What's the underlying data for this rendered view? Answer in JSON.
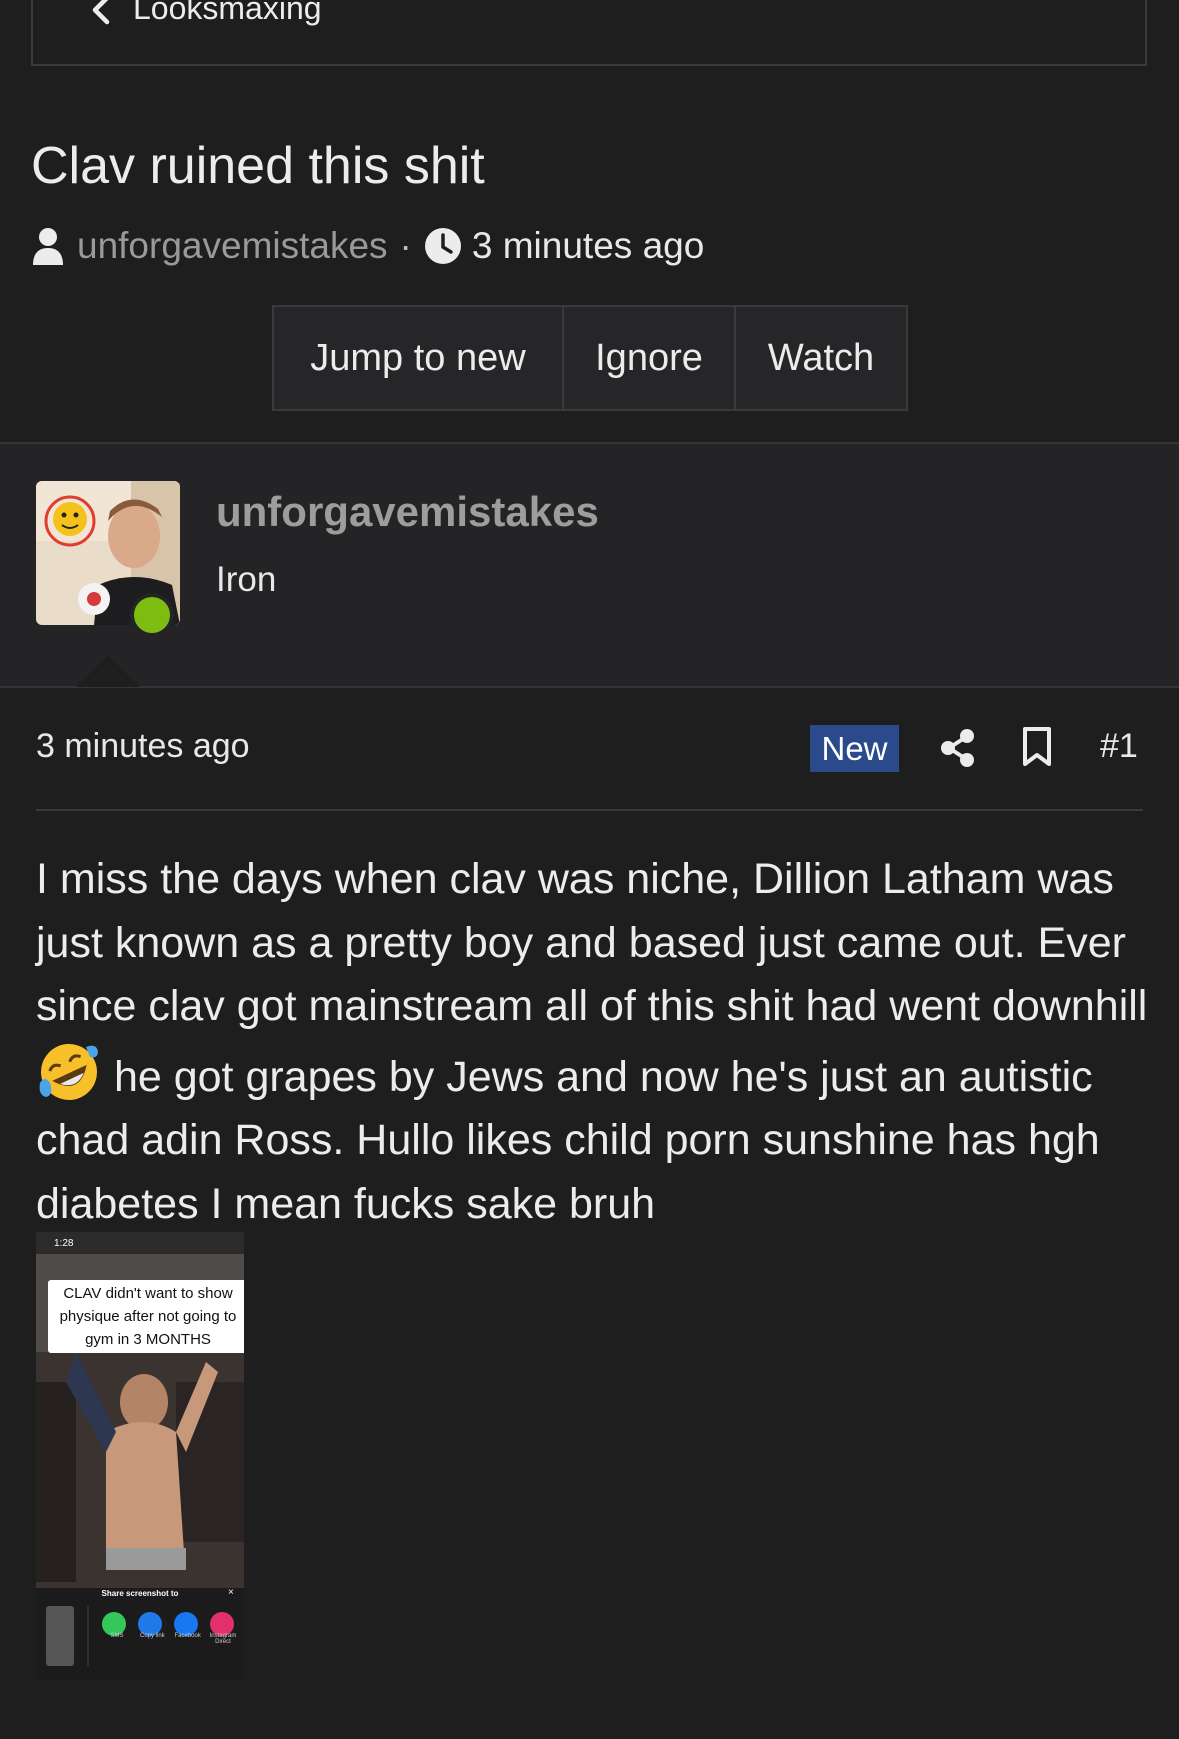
{
  "breadcrumb": {
    "label": "Looksmaxing"
  },
  "thread": {
    "title": "Clav ruined this shit",
    "author": "unforgavemistakes",
    "separator": "·",
    "time": "3 minutes ago"
  },
  "actions": {
    "jump_label": "Jump to new",
    "ignore_label": "Ignore",
    "watch_label": "Watch"
  },
  "user": {
    "name": "unforgavemistakes",
    "rank": "Iron",
    "online": true
  },
  "post": {
    "time": "3 minutes ago",
    "badge": "New",
    "number": "#1",
    "body_part1": "I miss the days when clav was niche, Dillion Latham was just known as a pretty boy and based just came out. Ever since clav got mainstream all of this shit had went downhill",
    "emoji": "rolling-on-floor-laughing-emoji",
    "body_part2": " he got grapes by Jews and now he's just an autistic chad adin Ross. Hullo likes child porn sunshine has hgh diabetes I mean fucks sake bruh"
  },
  "attachment": {
    "status_time": "1:28",
    "caption": "CLAV didn't want to show physique after not going to gym in 3 MONTHS",
    "share_title": "Share screenshot to",
    "share_close": "×",
    "share_targets": [
      "SMS",
      "Copy link",
      "Facebook",
      "Instagram Direct"
    ]
  },
  "icons": {
    "back": "chevron-left-icon",
    "author": "user-icon",
    "time": "clock-icon",
    "share": "share-icon",
    "bookmark": "bookmark-icon"
  },
  "colors": {
    "background": "#1e1e1f",
    "panel": "#242426",
    "online": "#7dbd12",
    "badge": "#2b4a8b",
    "muted_text": "#9a9a9a"
  }
}
